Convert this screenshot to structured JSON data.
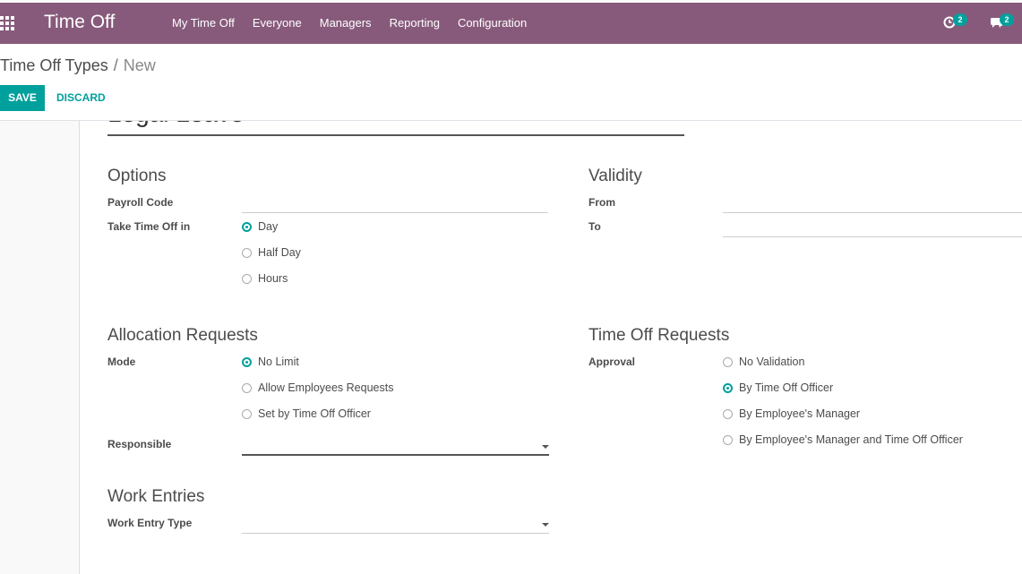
{
  "app": {
    "title": "Time Off"
  },
  "menu": [
    "My Time Off",
    "Everyone",
    "Managers",
    "Reporting",
    "Configuration"
  ],
  "systray": {
    "activity_count": "2",
    "messages_count": "2"
  },
  "breadcrumb": {
    "parent": "Time Off Types",
    "separator": "/",
    "current": "New"
  },
  "buttons": {
    "save": "SAVE",
    "discard": "DISCARD"
  },
  "record": {
    "name": "Legal Leave"
  },
  "options": {
    "title": "Options",
    "payroll_code_label": "Payroll Code",
    "payroll_code_value": "",
    "take_time_off_label": "Take Time Off in",
    "take_time_off_options": [
      "Day",
      "Half Day",
      "Hours"
    ],
    "take_time_off_selected": "Day"
  },
  "validity": {
    "title": "Validity",
    "from_label": "From",
    "to_label": "To"
  },
  "allocation": {
    "title": "Allocation Requests",
    "mode_label": "Mode",
    "mode_options": [
      "No Limit",
      "Allow Employees Requests",
      "Set by Time Off Officer"
    ],
    "mode_selected": "No Limit",
    "responsible_label": "Responsible",
    "responsible_value": ""
  },
  "time_off_requests": {
    "title": "Time Off Requests",
    "approval_label": "Approval",
    "approval_options": [
      "No Validation",
      "By Time Off Officer",
      "By Employee's Manager",
      "By Employee's Manager and Time Off Officer"
    ],
    "approval_selected": "By Time Off Officer"
  },
  "work_entries": {
    "title": "Work Entries",
    "work_entry_type_label": "Work Entry Type",
    "work_entry_type_value": ""
  },
  "colors": {
    "brand": "#875a7b",
    "accent": "#00a09d"
  }
}
